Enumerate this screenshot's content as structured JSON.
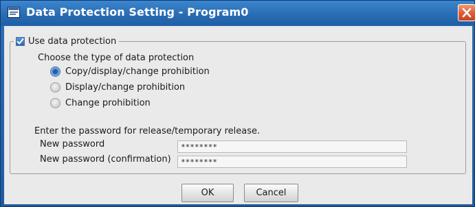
{
  "window": {
    "title": "Data Protection Setting - Program0"
  },
  "icons": {
    "app": "window-settings-icon",
    "close": "close-icon"
  },
  "colors": {
    "title_bar": "#2a6db4",
    "close_button": "#e0603a",
    "client_background": "#eaeaea"
  },
  "protection": {
    "enabled_label": "Use data protection",
    "enabled": true,
    "type_prompt": "Choose the type of data protection",
    "options": [
      {
        "label": "Copy/display/change prohibition",
        "selected": true
      },
      {
        "label": "Display/change prohibition",
        "selected": false
      },
      {
        "label": "Change prohibition",
        "selected": false
      }
    ]
  },
  "password": {
    "intro": "Enter the password for release/temporary release.",
    "new_label": "New password",
    "new_value": "********",
    "confirm_label": "New password (confirmation)",
    "confirm_value": "********"
  },
  "buttons": {
    "ok": "OK",
    "cancel": "Cancel"
  }
}
